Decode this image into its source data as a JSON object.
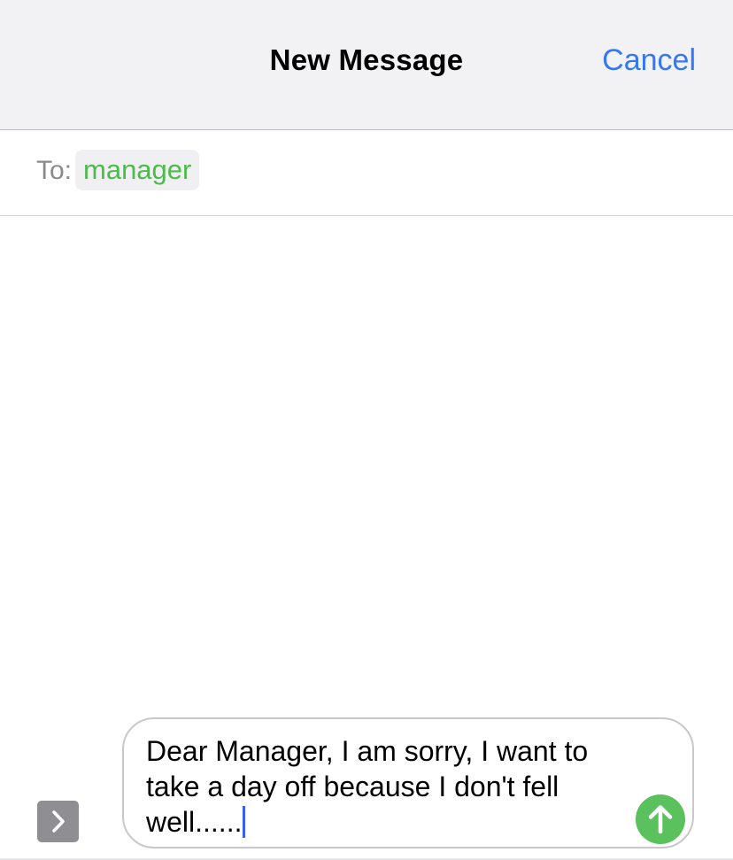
{
  "nav": {
    "title": "New Message",
    "cancel_label": "Cancel"
  },
  "recipients": {
    "to_label": "To:",
    "chips": [
      "manager"
    ]
  },
  "composer": {
    "text": "Dear Manager, I am sorry, I want to take a day off because I don't fell well......",
    "apps_icon": "chevron-right-icon",
    "send_icon": "arrow-up-icon"
  },
  "colors": {
    "accent": "#3478f6",
    "recipient": "#4bbb4b",
    "send": "#5ac15c",
    "caret": "#3a5ff6"
  }
}
